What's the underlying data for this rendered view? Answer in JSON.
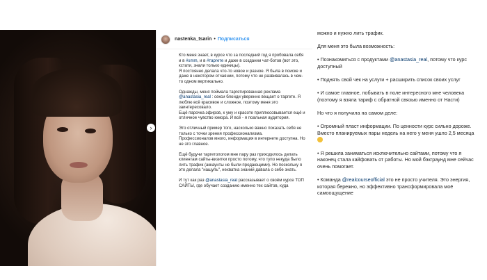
{
  "post": {
    "username": "nastenka_tsarin",
    "separator": "•",
    "follow_label": "Подписаться",
    "paragraphs": [
      {
        "pre": "Кто меня знает, в курсе что за последний год я пробовала себя и в ",
        "tag1": "#smm",
        "mid": ", и в ",
        "tag2": "#таргете",
        "post": " и даже в создании чат-ботов (вот это, кстати, знали только единицы).\nЯ постоянно делала что-то новое и разное. Я была в поиске и даже в некотором отчаянии, потому что не развивалась в чем-то одном вертикально."
      },
      {
        "pre": "Однажды, меня поймала таргетированная реклама ",
        "mention": "@anastasia_real",
        "post": " : секси блонди уверенно вещает о таргете. Я люблю всё красивое и сложное, поэтому меня это заинтересовало.\nЕщё парочка эфиров, к уму и красоте приплюсовывается ещё и отличное чувство юмора. И всё - я поальная аудитория."
      },
      {
        "text": "Это отличный пример того, насколько важно показать себя не только с точки зрения профессионализма.\nПрофессионалов много, информация в интернете доступна. Но не это главное."
      },
      {
        "text": "Ещё будучи таргетологом мне пару раз приходилось делать клиентам сайты-визитки просто потому, что тупо некуда было лить трафик (аккаунты не были продающими). Но поскольку я это делала \"нащупь\", нехватка знаний давала о себе знать."
      },
      {
        "pre": "И тут как раз ",
        "mention": "@anastasia_real",
        "post": " рассказывает о своём курсе ТОП САЙТЫ, где обучает созданию именно тех сайтов, куда"
      }
    ]
  },
  "right": {
    "p1": "можно и нужно лить трафик.",
    "p2": "Для меня это была возможность:",
    "p3_pre": "• Познакомиться с продуктами ",
    "p3_mention": "@anastasia_real",
    "p3_post": ", потому что курс доступный",
    "p4": "• Поднять свой чек на услуги + расширить список своих услуг",
    "p5": "• И самое главное, побывать в поле интересного мне человека (поэтому я взяла тариф с обратной связью именно от Насти)",
    "p6": "Но что я получила на самом деле:",
    "p7": "• Огромный пласт информации. По ценности курс сильно дороже. Вместо планируемых пары недель на него у меня ушло 2,5 месяца",
    "p8": "• Я решила заниматься исключительно сайтами, потому что я наконец стала кайфовать от работы. Но мой бэкграунд мне сейчас очень помогает.",
    "p9_pre": "• Команда ",
    "p9_mention": "@realcourseofficial",
    "p9_post": " это не просто учителя. Это энергия, которая бережно, но эффективно трансформировала моё самоощущение"
  },
  "icons": {
    "emoji": "sweat-smile-emoji",
    "carousel_next": "chevron-right-icon"
  },
  "colors": {
    "link": "#003569",
    "follow": "#3897f0"
  }
}
